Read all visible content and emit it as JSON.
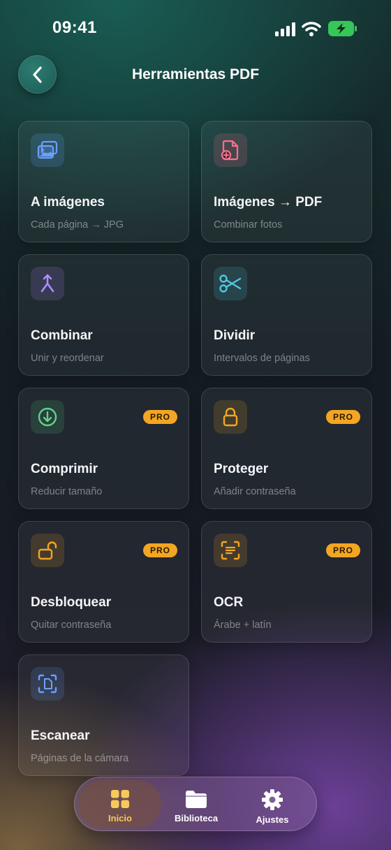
{
  "status_bar": {
    "time": "09:41"
  },
  "header": {
    "title": "Herramientas PDF"
  },
  "tools": [
    {
      "title": "A imágenes",
      "subtitle": "Cada página → JPG",
      "icon": "images-icon",
      "pro": false,
      "accent": "#6aa0ff"
    },
    {
      "title": "Imágenes → PDF",
      "subtitle": "Combinar fotos",
      "icon": "file-add-icon",
      "pro": false,
      "accent": "#ff6f8e"
    },
    {
      "title": "Combinar",
      "subtitle": "Unir y reordenar",
      "icon": "merge-icon",
      "pro": false,
      "accent": "#b38bff"
    },
    {
      "title": "Dividir",
      "subtitle": "Intervalos de páginas",
      "icon": "scissors-icon",
      "pro": false,
      "accent": "#53c7e0"
    },
    {
      "title": "Comprimir",
      "subtitle": "Reducir tamaño",
      "icon": "download-circle-icon",
      "pro": true,
      "accent": "#5fd38a"
    },
    {
      "title": "Proteger",
      "subtitle": "Añadir contraseña",
      "icon": "lock-icon",
      "pro": true,
      "accent": "#f3a623"
    },
    {
      "title": "Desbloquear",
      "subtitle": "Quitar contraseña",
      "icon": "unlock-icon",
      "pro": true,
      "accent": "#f3a623"
    },
    {
      "title": "OCR",
      "subtitle": "Árabe + latín",
      "icon": "text-scan-icon",
      "pro": true,
      "accent": "#f3a623"
    },
    {
      "title": "Escanear",
      "subtitle": "Páginas de la cámara",
      "icon": "document-scan-icon",
      "pro": false,
      "accent": "#6aa0ff"
    }
  ],
  "pro_label": "PRO",
  "tab_bar": {
    "items": [
      {
        "label": "Inicio",
        "icon": "grid-icon",
        "active": true
      },
      {
        "label": "Biblioteca",
        "icon": "folder-icon",
        "active": false
      },
      {
        "label": "Ajustes",
        "icon": "gear-icon",
        "active": false
      }
    ],
    "active_color": "#f7c95d"
  }
}
